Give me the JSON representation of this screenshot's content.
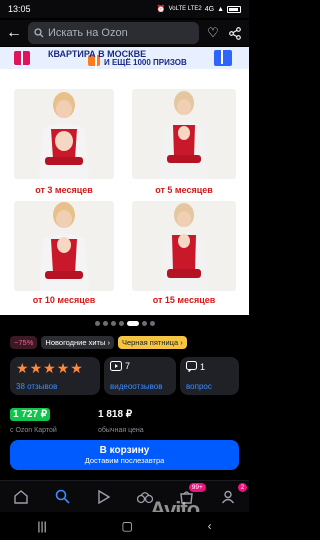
{
  "status_bar": {
    "time": "13:05",
    "network_label": "VoLTE LTE2",
    "signal": "4G",
    "battery_icon": "battery-icon"
  },
  "search": {
    "placeholder": "Искать на Ozon",
    "back_icon": "back-arrow-icon",
    "heart_icon": "heart-icon",
    "share_icon": "share-icon"
  },
  "banner": {
    "line1": "КВАРТИРА В МОСКВЕ",
    "line2": "И ЕЩЁ 1000 ПРИЗОВ"
  },
  "product": {
    "captions": [
      "от 3 месяцев",
      "от 5 месяцев",
      "от 10 месяцев",
      "от 15 месяцев"
    ],
    "gallery_dots": 7,
    "active_dot": 4
  },
  "tags": {
    "discount": "−75%",
    "hits": "Новогодние хиты",
    "friday": "Черная пятница"
  },
  "stats": {
    "reviews_label": "38 отзывов",
    "video_count": "7",
    "video_label": "видеоотзывов",
    "question_count": "1",
    "question_label": "вопрос"
  },
  "prices": {
    "ozon_price": "1 727 ₽",
    "ozon_label": "с Ozon Картой",
    "normal_price": "1 818 ₽",
    "normal_label": "обычная цена"
  },
  "cart": {
    "label": "В корзину",
    "sub_label": "Доставим послезавтра"
  },
  "bottom_nav": {
    "cart_badge": "99+",
    "profile_badge": "2"
  },
  "watermark": "Avito",
  "colors": {
    "accent": "#005bff",
    "ozon_green": "#10c44c",
    "star": "#ff8a3d",
    "badge": "#f1117e"
  }
}
